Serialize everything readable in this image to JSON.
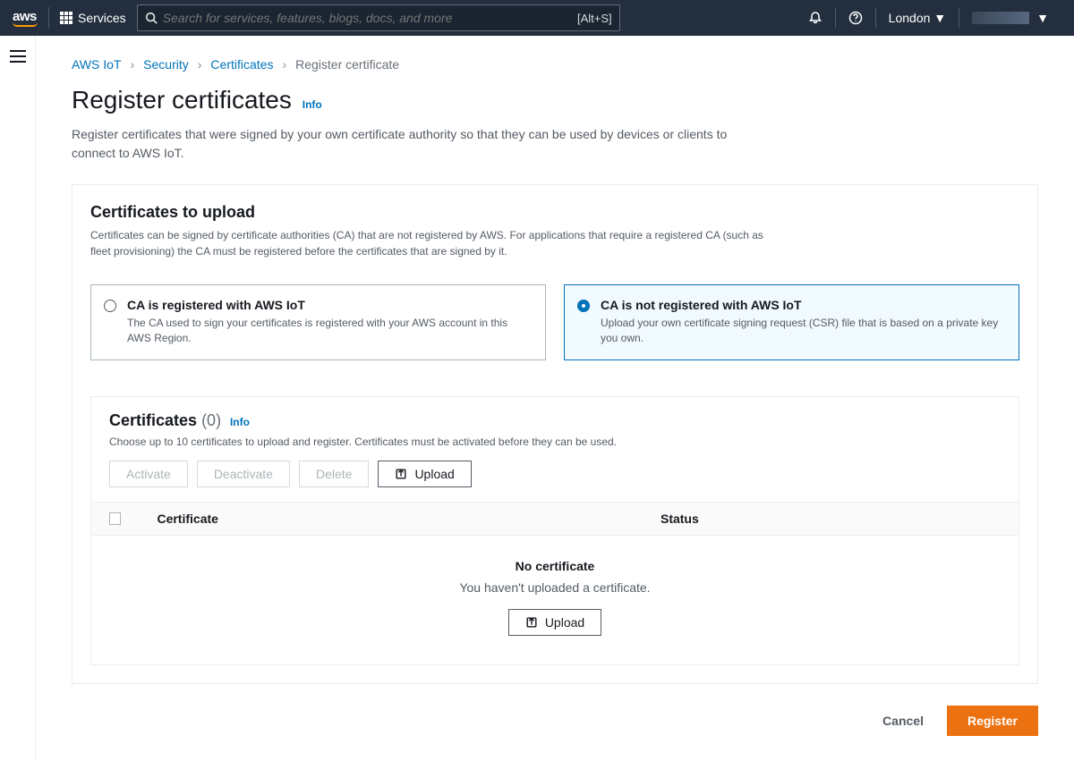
{
  "nav": {
    "services_label": "Services",
    "search_placeholder": "Search for services, features, blogs, docs, and more",
    "search_shortcut": "[Alt+S]",
    "region": "London"
  },
  "breadcrumbs": {
    "items": [
      "AWS IoT",
      "Security",
      "Certificates"
    ],
    "current": "Register certificate"
  },
  "header": {
    "title": "Register certificates",
    "info": "Info",
    "description": "Register certificates that were signed by your own certificate authority so that they can be used by devices or clients to connect to AWS IoT."
  },
  "upload_card": {
    "title": "Certificates to upload",
    "description": "Certificates can be signed by certificate authorities (CA) that are not registered by AWS. For applications that require a registered CA (such as fleet provisioning) the CA must be registered before the certificates that are signed by it.",
    "options": [
      {
        "title": "CA is registered with AWS IoT",
        "desc": "The CA used to sign your certificates is registered with your AWS account in this AWS Region."
      },
      {
        "title": "CA is not registered with AWS IoT",
        "desc": "Upload your own certificate signing request (CSR) file that is based on a private key you own."
      }
    ]
  },
  "certs_panel": {
    "title": "Certificates",
    "count": "(0)",
    "info": "Info",
    "sub": "Choose up to 10 certificates to upload and register. Certificates must be activated before they can be used.",
    "buttons": {
      "activate": "Activate",
      "deactivate": "Deactivate",
      "delete": "Delete",
      "upload": "Upload"
    },
    "columns": {
      "certificate": "Certificate",
      "status": "Status"
    },
    "empty": {
      "title": "No certificate",
      "msg": "You haven't uploaded a certificate.",
      "upload": "Upload"
    }
  },
  "footer": {
    "cancel": "Cancel",
    "register": "Register"
  }
}
